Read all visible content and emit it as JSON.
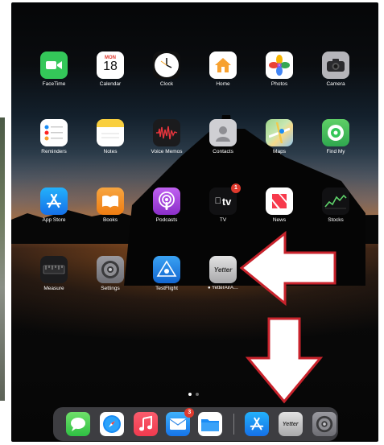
{
  "home_screen": {
    "rows": [
      [
        {
          "id": "facetime",
          "label": "FaceTime",
          "icon": "facetime-icon"
        },
        {
          "id": "calendar",
          "label": "Calendar",
          "icon": "calendar-icon",
          "day_name": "MON",
          "day_number": "18"
        },
        {
          "id": "clock",
          "label": "Clock",
          "icon": "clock-icon"
        },
        {
          "id": "home",
          "label": "Home",
          "icon": "home-icon"
        },
        {
          "id": "photos",
          "label": "Photos",
          "icon": "photos-icon"
        },
        {
          "id": "camera",
          "label": "Camera",
          "icon": "camera-icon"
        }
      ],
      [
        {
          "id": "reminders",
          "label": "Reminders",
          "icon": "reminders-icon"
        },
        {
          "id": "notes",
          "label": "Notes",
          "icon": "notes-icon"
        },
        {
          "id": "voice-memos",
          "label": "Voice Memos",
          "icon": "voice-memos-icon"
        },
        {
          "id": "contacts",
          "label": "Contacts",
          "icon": "contacts-icon"
        },
        {
          "id": "maps",
          "label": "Maps",
          "icon": "maps-icon"
        },
        {
          "id": "find-my",
          "label": "Find My",
          "icon": "find-my-icon"
        }
      ],
      [
        {
          "id": "app-store",
          "label": "App Store",
          "icon": "app-store-icon"
        },
        {
          "id": "books",
          "label": "Books",
          "icon": "books-icon"
        },
        {
          "id": "podcasts",
          "label": "Podcasts",
          "icon": "podcasts-icon"
        },
        {
          "id": "tv",
          "label": "TV",
          "icon": "apple-tv-icon",
          "badge": "1",
          "icon_text": "tv"
        },
        {
          "id": "news",
          "label": "News",
          "icon": "news-icon"
        },
        {
          "id": "stocks",
          "label": "Stocks",
          "icon": "stocks-icon"
        }
      ],
      [
        {
          "id": "measure",
          "label": "Measure",
          "icon": "measure-icon"
        },
        {
          "id": "settings",
          "label": "Settings",
          "icon": "settings-icon"
        },
        {
          "id": "testflight",
          "label": "TestFlight",
          "icon": "testflight-icon"
        },
        {
          "id": "yetter",
          "label": "● YetterAirA…",
          "icon": "yetter-icon",
          "icon_text": "Yetter"
        }
      ]
    ],
    "page_dots": 2,
    "active_page": 1
  },
  "dock": {
    "items": [
      {
        "id": "messages",
        "icon": "messages-icon"
      },
      {
        "id": "safari",
        "icon": "safari-icon"
      },
      {
        "id": "music",
        "icon": "music-icon"
      },
      {
        "id": "mail",
        "icon": "mail-icon",
        "badge": "3"
      },
      {
        "id": "files",
        "icon": "files-icon"
      },
      {
        "id": "app-store",
        "icon": "app-store-icon"
      },
      {
        "id": "yetter",
        "icon": "yetter-icon",
        "icon_text": "Yetter"
      },
      {
        "id": "settings",
        "icon": "settings-icon"
      }
    ]
  },
  "annotations": {
    "arrow_left_color": "#c8232c",
    "arrow_down_color": "#c8232c"
  },
  "colors": {
    "facetime": "#34c759",
    "home": "#f7a130",
    "app_store": "#1a8cf5",
    "books": "#f28c1d",
    "podcasts": "#9b3fd6",
    "testflight": "#1f85e0",
    "badge": "#e03a2e"
  }
}
